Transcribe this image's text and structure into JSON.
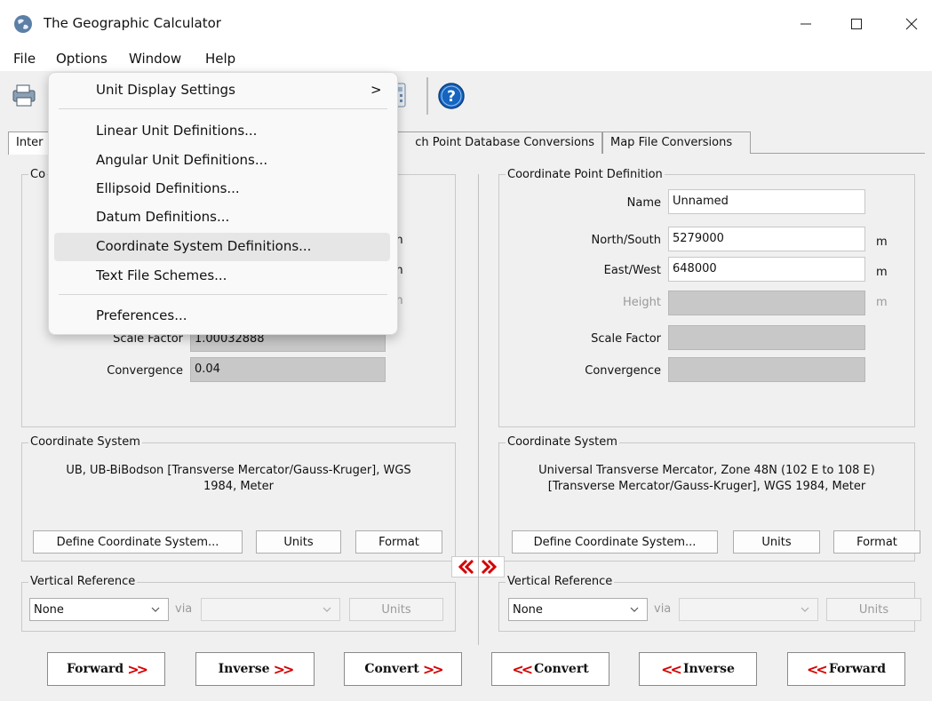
{
  "window": {
    "title": "The Geographic Calculator",
    "minimize": "—",
    "maximize": "☐",
    "close": "✕"
  },
  "menubar": {
    "items": [
      {
        "label": "File"
      },
      {
        "label": "Options"
      },
      {
        "label": "Window"
      },
      {
        "label": "Help"
      }
    ]
  },
  "options_menu": {
    "items": [
      {
        "label": "Unit Display Settings",
        "submenu_arrow": ">"
      },
      {
        "label": "Linear Unit Definitions..."
      },
      {
        "label": "Angular Unit Definitions..."
      },
      {
        "label": "Ellipsoid Definitions..."
      },
      {
        "label": "Datum Definitions..."
      },
      {
        "label": "Coordinate System Definitions..."
      },
      {
        "label": "Text File Schemes..."
      },
      {
        "label": "Preferences..."
      }
    ],
    "highlighted_index": 5
  },
  "tabs": [
    {
      "label": "Interactive Conversions",
      "visible_label": "Inter",
      "active": true
    },
    {
      "label": "ch Point Database Conversions"
    },
    {
      "label": "Map File Conversions"
    }
  ],
  "left": {
    "cpd_label": "Co",
    "units": [
      "m",
      "m",
      "m"
    ],
    "scale_factor_label": "Scale Factor",
    "scale_factor": "1.00032888",
    "convergence_label": "Convergence",
    "convergence": "0.04",
    "cs_label": "Coordinate System",
    "cs_desc_line1": "UB, UB-BiBodson [Transverse Mercator/Gauss-Kruger], WGS",
    "cs_desc_line2": "1984, Meter",
    "define_btn": "Define Coordinate System...",
    "units_btn": "Units",
    "format_btn": "Format",
    "vr_label": "Vertical Reference",
    "vr_value": "None",
    "via": "via",
    "vr_units_btn": "Units"
  },
  "right": {
    "cpd_label": "Coordinate Point Definition",
    "name_label": "Name",
    "name_value": "Unnamed",
    "ns_label": "North/South",
    "ns_value": "5279000",
    "ns_unit": "m",
    "ew_label": "East/West",
    "ew_value": "648000",
    "ew_unit": "m",
    "height_label": "Height",
    "height_unit": "m",
    "scale_factor_label": "Scale Factor",
    "convergence_label": "Convergence",
    "cs_label": "Coordinate System",
    "cs_desc_line1": "Universal Transverse Mercator, Zone 48N (102 E to 108 E)",
    "cs_desc_line2": "[Transverse Mercator/Gauss-Kruger], WGS 1984, Meter",
    "define_btn": "Define Coordinate System...",
    "units_btn": "Units",
    "format_btn": "Format",
    "vr_label": "Vertical Reference",
    "vr_value": "None",
    "via": "via",
    "vr_units_btn": "Units"
  },
  "actions": {
    "forward": "Forward",
    "inverse": "Inverse",
    "convert": "Convert",
    "convert_back": "Convert",
    "inverse_back": "Inverse",
    "forward_back": "Forward"
  },
  "colors": {
    "arrow_red": "#d40000",
    "help_blue": "#1565c0",
    "disabled_field": "#c8c8c8"
  }
}
